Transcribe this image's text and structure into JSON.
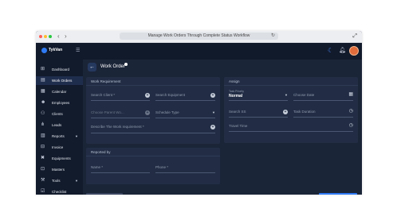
{
  "browser": {
    "address_text": "Manage Work Orders Through Complete Status Workflow",
    "dot_colors": [
      "#ff5f57",
      "#febc2e",
      "#28c840"
    ]
  },
  "topbar": {
    "brand": "TykVan",
    "icons": [
      "hamburger-icon",
      "moon-icon",
      "bell-icon",
      "avatar"
    ]
  },
  "sidebar": {
    "items": [
      {
        "label": "Dashboard",
        "icon": "dashboard-icon",
        "active": false
      },
      {
        "label": "Work Orders",
        "icon": "work-orders-icon",
        "active": true
      },
      {
        "label": "Calendar",
        "icon": "calendar-icon",
        "active": false
      },
      {
        "label": "Employees",
        "icon": "employees-icon",
        "active": false
      },
      {
        "label": "Clients",
        "icon": "clients-icon",
        "active": false
      },
      {
        "label": "Leads",
        "icon": "leads-icon",
        "active": false
      },
      {
        "label": "Reports",
        "icon": "reports-icon",
        "active": false,
        "has_caret": true
      },
      {
        "label": "Invoice",
        "icon": "invoice-icon",
        "active": false
      },
      {
        "label": "Equipments",
        "icon": "equipments-icon",
        "active": false
      },
      {
        "label": "Masters",
        "icon": "masters-icon",
        "active": false
      },
      {
        "label": "Tools",
        "icon": "tools-icon",
        "active": false,
        "has_caret": true
      },
      {
        "label": "Checklist",
        "icon": "checklist-icon",
        "active": false
      }
    ]
  },
  "page": {
    "title": "Work Order"
  },
  "work_requirement": {
    "title": "Work Requirement",
    "search_client": "Search Client *",
    "search_equipment": "Search Equipment",
    "choose_parent": "Choose Parent Wo...",
    "schedule_type": "Schedule Type",
    "describe": "Describe The Work requirement *"
  },
  "reported_by": {
    "title": "Reported by",
    "name": "Name *",
    "phone": "Phone *"
  },
  "assign": {
    "title": "Assign",
    "task_priority_label": "Task Priority",
    "task_priority_value": "Normal",
    "choose_date": "Choose Date",
    "search_ss": "Search SS",
    "task_duration": "Task Duration",
    "travel_time": "Travel Time"
  },
  "colors": {
    "accent": "#2f7bf5",
    "background": "#1b2538",
    "card": "#222d45",
    "sidebar": "#121b2c"
  }
}
